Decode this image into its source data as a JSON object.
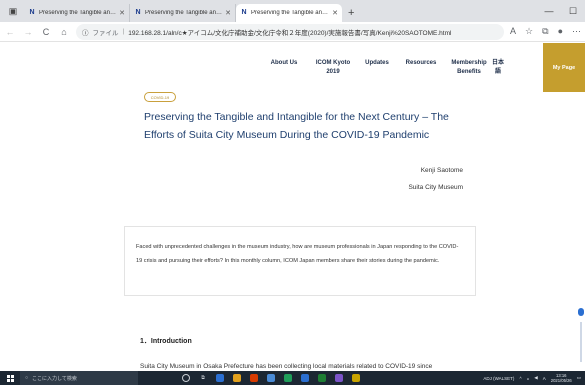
{
  "browser": {
    "tabs": [
      {
        "title": "Preserving the Tangible and Intan"
      },
      {
        "title": "Preserving the Tangible and Intan"
      },
      {
        "title": "Preserving the Tangible and Intan"
      }
    ],
    "new_tab": "+",
    "url_protocol": "ファイル",
    "url": "192.168.28.1/aln/c★アイコム/文化庁補助金/文化庁令和２年度(2020)/実施報告書/写真/Kenji%20SAOTOME.html"
  },
  "site_nav": {
    "links": [
      {
        "label": "About Us"
      },
      {
        "label": "ICOM Kyoto 2019"
      },
      {
        "label": "Updates"
      },
      {
        "label": "Resources"
      },
      {
        "label": "Membership Benefits"
      },
      {
        "label": "日本語"
      }
    ],
    "my_page": "My Page"
  },
  "article": {
    "tag": "COVID-19",
    "title": "Preserving the Tangible and Intangible for the Next Century – The Efforts of Suita City Museum During the COVID-19 Pandemic",
    "author_name": "Kenji Saotome",
    "author_affiliation": "Suita City Museum",
    "summary": "Faced with unprecedented challenges in the museum industry, how are museum professionals in Japan responding to the COVID-19 crisis and pursuing their efforts? In this monthly column, ICOM Japan members share their stories during the pandemic.",
    "section_heading": "1．Introduction",
    "body_first_line": "Suita City Museum in Osaka Prefecture has been collecting local materials related to COVID-19 since"
  },
  "taskbar": {
    "search_placeholder": "ここに入力して検索",
    "ime": "A",
    "tray_text": "ADJ (WALSET)",
    "time": "13:16",
    "date": "2021/05/26"
  }
}
